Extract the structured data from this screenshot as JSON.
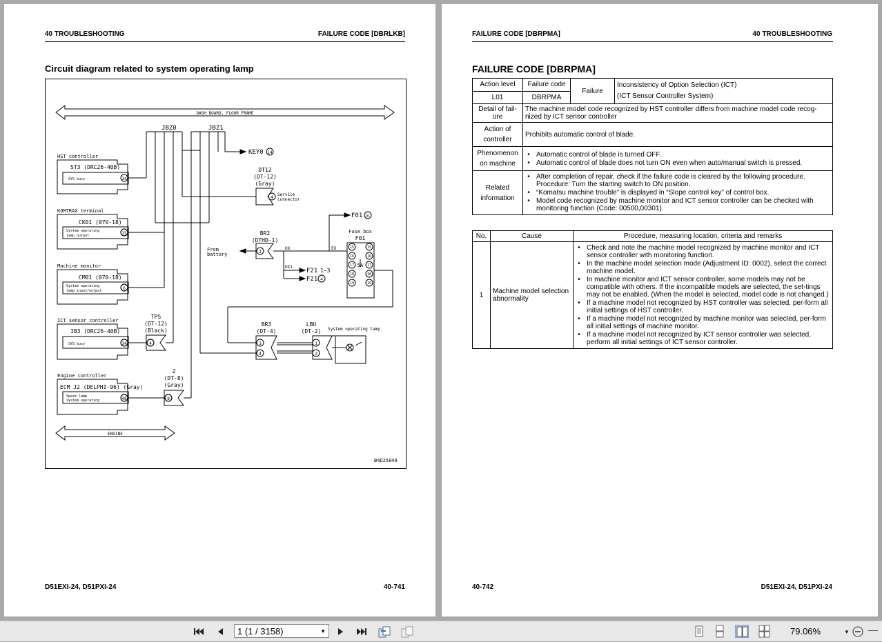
{
  "left_page": {
    "header_left": "40 TROUBLESHOOTING",
    "header_right": "FAILURE CODE [DBRLKB]",
    "section_title": "Circuit diagram related to system operating lamp",
    "footer_left": "D51EXI-24, D51PXI-24",
    "footer_right": "40-741",
    "diagram": {
      "dash_board": "DASH BOARD, FLOOR FRAME",
      "engine": "ENGINE",
      "jbz0": "JBZ0",
      "jbz1": "JBZ1",
      "key0": "KEY0",
      "key0_pin": "14",
      "hst_title": "HST controller",
      "hst_conn": "ST3 (DRC26-40B)",
      "hst_sig": "SYS busy",
      "hst_pin": "34",
      "dt12_a": "DT12",
      "dt12_b": "(DT-12)",
      "dt12_c": "(Gray)",
      "dt12_pin": "4",
      "service_a": "Service",
      "service_b": "connector",
      "kom_title": "KOMTRAX terminal",
      "kom_conn": "CK01 (070-18)",
      "kom_sig_a": "System operating",
      "kom_sig_b": "lamp output",
      "kom_pin": "15",
      "f01_label": "F01",
      "f01_pin": "9C",
      "fusebox_a": "Fuse box",
      "fusebox_b": "F01",
      "br2_a": "BR2",
      "br2_b": "(DTHD-1)",
      "br2_pin": "1",
      "from_a": "From",
      "from_b": "battery",
      "ux": "UX",
      "ex": "EX",
      "ux1": "UX1",
      "f21a": "F21",
      "f21a_pins": "1~3",
      "f21b": "F21",
      "f21b_pin": "4",
      "fuse_5a": "5A",
      "fuse_left": [
        "15",
        "16",
        "17",
        "18",
        "19"
      ],
      "fuse_right": [
        "15",
        "16",
        "17",
        "18",
        "19"
      ],
      "mm_title": "Machine monitor",
      "mm_conn": "CM01 (070-18)",
      "mm_sig_a": "System operating",
      "mm_sig_b": "lamp input/output",
      "mm_pin": "6",
      "ict_title": "ICT sensor controller",
      "ict_conn": "IB3 (DRC26-40B)",
      "ict_sig": "SYS busy",
      "ict_pin": "34",
      "tps_a": "TPS",
      "tps_b": "(DT-12)",
      "tps_c": "(Black)",
      "tps_pin": "4",
      "br3_a": "BR3",
      "br3_b": "(DT-4)",
      "br3_pins": [
        "3",
        "4"
      ],
      "lbu_a": "LBU",
      "lbu_b": "(DT-2)",
      "lbu_pins": [
        "1",
        "2"
      ],
      "sol_title": "System operating lamp",
      "ecm_title": "Engine controller",
      "ecm_conn": "ECM J2 (DELPHI-96) (Gray)",
      "ecm_sig_a": "Spare lamp",
      "ecm_sig_b": "system operating",
      "ecm_pin": "48",
      "c2_a": "2",
      "c2_b": "(DT-8)",
      "c2_c": "(Gray)",
      "c2_pin": "8",
      "fig_no": "B4D25849"
    }
  },
  "right_page": {
    "header_left": "FAILURE CODE [DBRPMA]",
    "header_right": "40 TROUBLESHOOTING",
    "title": "FAILURE CODE [DBRPMA]",
    "footer_left": "40-742",
    "footer_right": "D51EXI-24, D51PXI-24",
    "info": {
      "action_level_h": "Action level",
      "failure_code_h": "Failure code",
      "failure_h": "Failure",
      "action_level": "L01",
      "failure_code": "DBRPMA",
      "failure_a": "Inconsistency of Option Selection (ICT)",
      "failure_b": "(ICT Sensor Controller System)",
      "detail_h": "Detail of fail-ure",
      "detail": "The machine model code recognized by HST controller differs from machine model code recog-nized by ICT sensor controller",
      "action_h": "Action of controller",
      "action": "Prohibits automatic control of blade.",
      "phen_h": "Phenomenon on machine",
      "phen": [
        "Automatic control of blade is turned OFF.",
        "Automatic control of blade does not turn ON even when auto/manual switch is pressed."
      ],
      "related_h": "Related information",
      "related": [
        "After completion of repair, check if the failure code is cleared by the following procedure. Procedure: Turn the starting switch to ON position.",
        "“Komatsu machine trouble” is displayed in “Slope control key” of control box.",
        "Model code recognized by machine monitor and ICT sensor controller can be checked with monitoring function (Code: 00500,00301)."
      ]
    },
    "causes": {
      "no_h": "No.",
      "cause_h": "Cause",
      "proc_h": "Procedure, measuring location, criteria and remarks",
      "rows": [
        {
          "no": "1",
          "cause": "Machine model selection abnormality",
          "items": [
            "Check and note the machine model recognized by machine monitor and ICT sensor controller with monitoring function.",
            "In the machine model selection mode (Adjustment ID: 0002), select the correct machine model.",
            "In machine monitor and ICT sensor controller, some models may not be compatible with others. If the incompatible models are selected, the set-tings may not be enabled. (When the model is selected, model code is not changed.)",
            "If a machine model not recognized by HST controller was selected, per-form all initial settings of HST controller.",
            "If a machine model not recognized by machine monitor was selected, per-form all initial settings of machine monitor.",
            "If a machine model not recognized by ICT sensor controller was selected, perform all initial settings of ICT sensor controller."
          ]
        }
      ]
    }
  },
  "toolbar": {
    "page_value": "1 (1 / 3158)",
    "zoom": "79.06%",
    "icons": [
      "first-page-icon",
      "prev-page-icon",
      "next-page-icon",
      "last-page-icon",
      "back-view-icon",
      "forward-view-icon",
      "single-page-icon",
      "continuous-icon",
      "facing-icon",
      "continuous-facing-icon",
      "zoom-dropdown-icon",
      "zoom-out-icon"
    ]
  }
}
